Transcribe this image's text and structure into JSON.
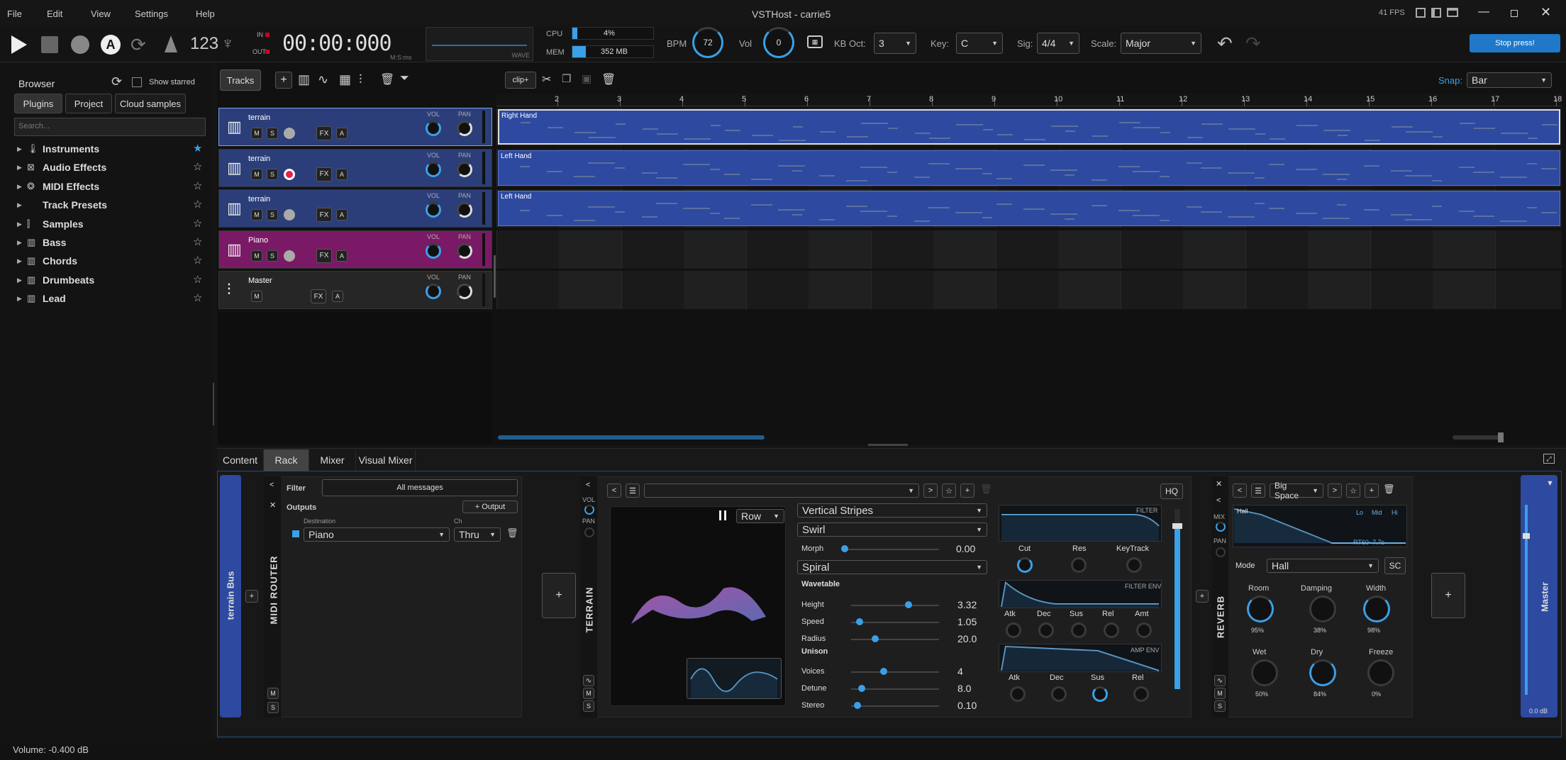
{
  "app": {
    "title": "VSTHost - carrie5",
    "fps": "41 FPS"
  },
  "menu": [
    "File",
    "Edit",
    "View",
    "Settings",
    "Help"
  ],
  "transport": {
    "counter": "123",
    "time": "00:00:000",
    "time_sub": "M:S:ms",
    "in_label": "IN",
    "out_label": "OUT",
    "wave_label": "WAVE",
    "cpu_label": "CPU",
    "cpu_value": "4%",
    "cpu_fraction": 0.04,
    "mem_label": "MEM",
    "mem_value": "352 MB",
    "mem_fraction": 0.05,
    "bpm_label": "BPM",
    "bpm_value": "72",
    "vol_label": "Vol",
    "vol_value": "0",
    "kboct_label": "KB Oct:",
    "kboct_value": "3",
    "key_label": "Key:",
    "key_value": "C",
    "sig_label": "Sig:",
    "sig_value": "4/4",
    "scale_label": "Scale:",
    "scale_value": "Major",
    "stop_press": "Stop press!"
  },
  "browser": {
    "title": "Browser",
    "show_starred": "Show starred",
    "tabs": [
      "Plugins",
      "Project",
      "Cloud samples"
    ],
    "search_placeholder": "Search...",
    "items": [
      {
        "label": "Instruments",
        "icon": "instrument-icon",
        "starred": true
      },
      {
        "label": "Audio Effects",
        "icon": "fx-icon",
        "starred": false
      },
      {
        "label": "MIDI Effects",
        "icon": "midi-icon",
        "starred": false
      },
      {
        "label": "Track Presets",
        "icon": "",
        "starred": false
      },
      {
        "label": "Samples",
        "icon": "wave-icon",
        "starred": false
      },
      {
        "label": "Bass",
        "icon": "piano-icon",
        "starred": false
      },
      {
        "label": "Chords",
        "icon": "piano-icon",
        "starred": false
      },
      {
        "label": "Drumbeats",
        "icon": "piano-icon",
        "starred": false
      },
      {
        "label": "Lead",
        "icon": "piano-icon",
        "starred": false
      }
    ]
  },
  "tracks_toolbar": {
    "tab": "Tracks",
    "clip_label": "clip+",
    "snap_label": "Snap:",
    "snap_value": "Bar"
  },
  "ruler": [
    "2",
    "3",
    "4",
    "5",
    "6",
    "7",
    "8",
    "9",
    "10",
    "11",
    "12",
    "13",
    "14",
    "15",
    "16",
    "17",
    "18"
  ],
  "tracks": [
    {
      "name": "terrain",
      "color": "#2b3e7a",
      "record": false,
      "clip": "Right Hand",
      "vol": "VOL",
      "pan": "PAN",
      "fx": "FX",
      "a": "A",
      "m": "M",
      "s": "S"
    },
    {
      "name": "terrain",
      "color": "#2b3e7a",
      "record": true,
      "clip": "Left Hand",
      "vol": "VOL",
      "pan": "PAN",
      "fx": "FX",
      "a": "A",
      "m": "M",
      "s": "S"
    },
    {
      "name": "terrain",
      "color": "#2b3e7a",
      "record": false,
      "clip": "Left Hand",
      "vol": "VOL",
      "pan": "PAN",
      "fx": "FX",
      "a": "A",
      "m": "M",
      "s": "S"
    },
    {
      "name": "Piano",
      "color": "#7a1a66",
      "record": false,
      "clip": "",
      "vol": "VOL",
      "pan": "PAN",
      "fx": "FX",
      "a": "A",
      "m": "M",
      "s": "S"
    },
    {
      "name": "Master",
      "color": "#262626",
      "record": false,
      "clip": "",
      "vol": "VOL",
      "pan": "PAN",
      "fx": "FX",
      "a": "A",
      "m": "M",
      "s": ""
    }
  ],
  "bottom_tabs": [
    "Content",
    "Rack",
    "Mixer",
    "Visual Mixer"
  ],
  "rack": {
    "bus_label": "terrain Bus",
    "midi_router": {
      "title": "MIDI ROUTER",
      "filter_label": "Filter",
      "filter_value": "All messages",
      "outputs_label": "Outputs",
      "add_output": "+ Output",
      "dest_header": "Destination",
      "ch_header": "Ch",
      "dest_value": "Piano",
      "ch_value": "Thru",
      "m": "M",
      "s": "S"
    },
    "terrain": {
      "title": "TERRAIN",
      "vol": "VOL",
      "pan": "PAN",
      "row_value": "Row",
      "hq": "HQ",
      "m": "M",
      "s": "S",
      "dd1": "Vertical Stripes",
      "dd2": "Swirl",
      "morph_label": "Morph",
      "morph_value": "0.00",
      "dd3": "Spiral",
      "wavetable": "Wavetable",
      "height_label": "Height",
      "height_value": "3.32",
      "speed_label": "Speed",
      "speed_value": "1.05",
      "radius_label": "Radius",
      "radius_value": "20.0",
      "unison": "Unison",
      "voices_label": "Voices",
      "voices_value": "4",
      "detune_label": "Detune",
      "detune_value": "8.0",
      "stereo_label": "Stereo",
      "stereo_value": "0.10",
      "filter_label": "FILTER",
      "cut": "Cut",
      "res": "Res",
      "keytrack": "KeyTrack",
      "filter_env": "FILTER ENV",
      "atk": "Atk",
      "dec": "Dec",
      "sus": "Sus",
      "rel": "Rel",
      "amt": "Amt",
      "amp_env": "AMP ENV"
    },
    "reverb": {
      "title": "REVERB",
      "mix": "MIX",
      "pan": "PAN",
      "preset": "Big Space",
      "hall": "Hall",
      "rt60": "RT60~7.7s",
      "lo": "Lo",
      "mid": "Mid",
      "hi": "Hi",
      "mode_label": "Mode",
      "mode_value": "Hall",
      "sc": "SC",
      "room": "Room",
      "room_v": "95%",
      "damping": "Damping",
      "damping_v": "38%",
      "width": "Width",
      "width_v": "98%",
      "wet": "Wet",
      "wet_v": "50%",
      "dry": "Dry",
      "dry_v": "84%",
      "freeze": "Freeze",
      "freeze_v": "0%",
      "m": "M",
      "s": "S"
    },
    "master_label": "Master",
    "master_db": "0.0 dB"
  },
  "status": "Volume: -0.400 dB",
  "colors": {
    "accent": "#3aa0e8",
    "track_blue": "#2b3e7a",
    "track_pink": "#7a1a66",
    "record": "#e8204a"
  }
}
